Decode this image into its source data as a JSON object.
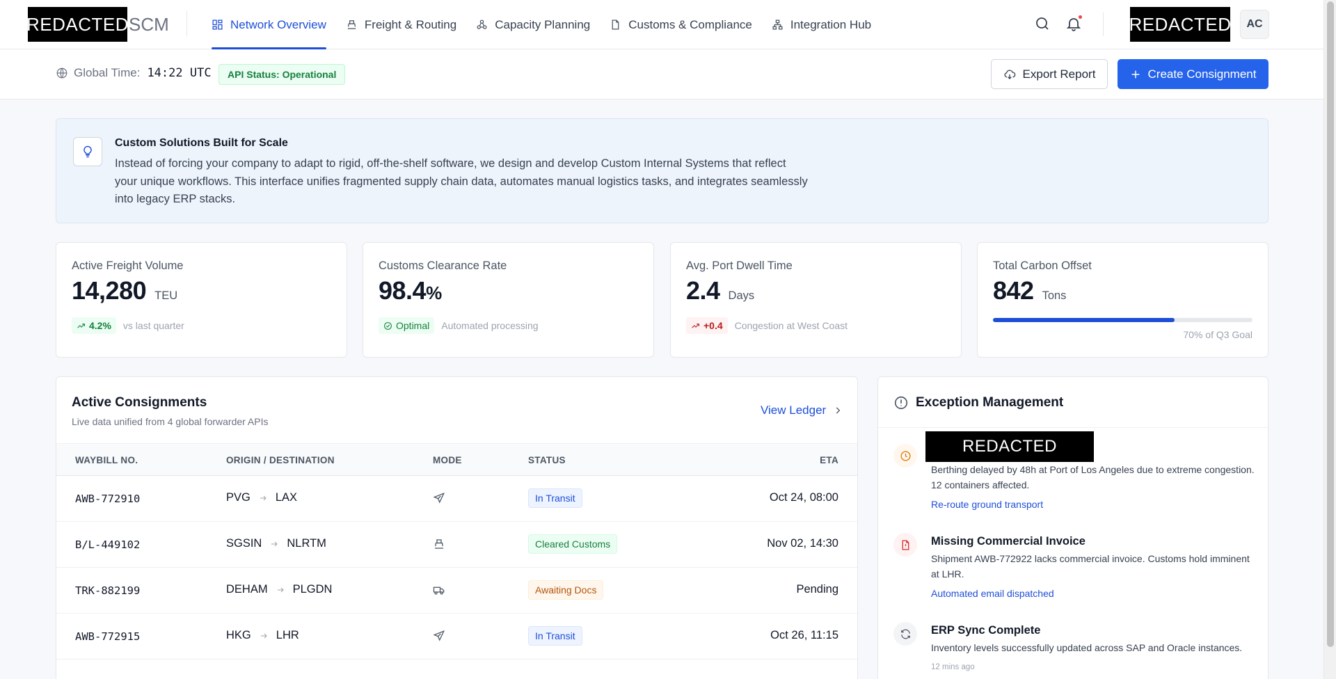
{
  "header": {
    "logo_redacted": "REDACTED",
    "logo_suffix": "SCM",
    "nav": [
      {
        "label": "Network Overview",
        "icon": "grid-icon",
        "active": true
      },
      {
        "label": "Freight & Routing",
        "icon": "ship-icon",
        "active": false
      },
      {
        "label": "Capacity Planning",
        "icon": "network-icon",
        "active": false
      },
      {
        "label": "Customs & Compliance",
        "icon": "document-icon",
        "active": false
      },
      {
        "label": "Integration Hub",
        "icon": "integration-icon",
        "active": false
      }
    ],
    "user_redacted": "REDACTED",
    "avatar_initials": "AC"
  },
  "subheader": {
    "global_time_label": "Global Time:",
    "global_time_value": "14:22 UTC",
    "api_status": "API Status: Operational",
    "export_label": "Export Report",
    "create_label": "Create Consignment"
  },
  "banner": {
    "title": "Custom Solutions Built for Scale",
    "text": "Instead of forcing your company to adapt to rigid, off-the-shelf software, we design and develop Custom Internal Systems that reflect your unique workflows. This interface unifies fragmented supply chain data, automates manual logistics tasks, and integrates seamlessly into legacy ERP stacks."
  },
  "kpis": [
    {
      "label": "Active Freight Volume",
      "value": "14,280",
      "unit": "TEU",
      "chip": "4.2%",
      "note": "vs last quarter"
    },
    {
      "label": "Customs Clearance Rate",
      "value": "98.4",
      "unit": "%",
      "chip": "Optimal",
      "note": "Automated processing"
    },
    {
      "label": "Avg. Port Dwell Time",
      "value": "2.4",
      "unit": "Days",
      "chip": "+0.4",
      "note": "Congestion at West Coast"
    },
    {
      "label": "Total Carbon Offset",
      "value": "842",
      "unit": "Tons",
      "progress": 0.7,
      "note": "70% of Q3 Goal"
    }
  ],
  "consignments": {
    "title": "Active Consignments",
    "subtitle": "Live data unified from 4 global forwarder APIs",
    "view_ledger": "View Ledger",
    "columns": [
      "WAYBILL NO.",
      "ORIGIN / DESTINATION",
      "MODE",
      "STATUS",
      "ETA"
    ],
    "rows": [
      {
        "waybill": "AWB-772910",
        "origin": "PVG",
        "destination": "LAX",
        "mode": "air",
        "status": "In Transit",
        "eta": "Oct 24, 08:00"
      },
      {
        "waybill": "B/L-449102",
        "origin": "SGSIN",
        "destination": "NLRTM",
        "mode": "sea",
        "status": "Cleared Customs",
        "eta": "Nov 02, 14:30"
      },
      {
        "waybill": "TRK-882199",
        "origin": "DEHAM",
        "destination": "PLGDN",
        "mode": "road",
        "status": "Awaiting Docs",
        "eta": "Pending"
      },
      {
        "waybill": "AWB-772915",
        "origin": "HKG",
        "destination": "LHR",
        "mode": "air",
        "status": "In Transit",
        "eta": "Oct 26, 11:15"
      }
    ]
  },
  "exceptions": {
    "title": "Exception Management",
    "items": [
      {
        "title_redacted": "REDACTED",
        "desc": "Berthing delayed by 48h at Port of Los Angeles due to extreme congestion. 12 containers affected.",
        "action": "Re-route ground transport"
      },
      {
        "title": "Missing Commercial Invoice",
        "desc": "Shipment AWB-772922 lacks commercial invoice. Customs hold imminent at LHR.",
        "action": "Automated email dispatched"
      },
      {
        "title": "ERP Sync Complete",
        "desc": "Inventory levels successfully updated across SAP and Oracle instances.",
        "time": "12 mins ago"
      }
    ]
  }
}
